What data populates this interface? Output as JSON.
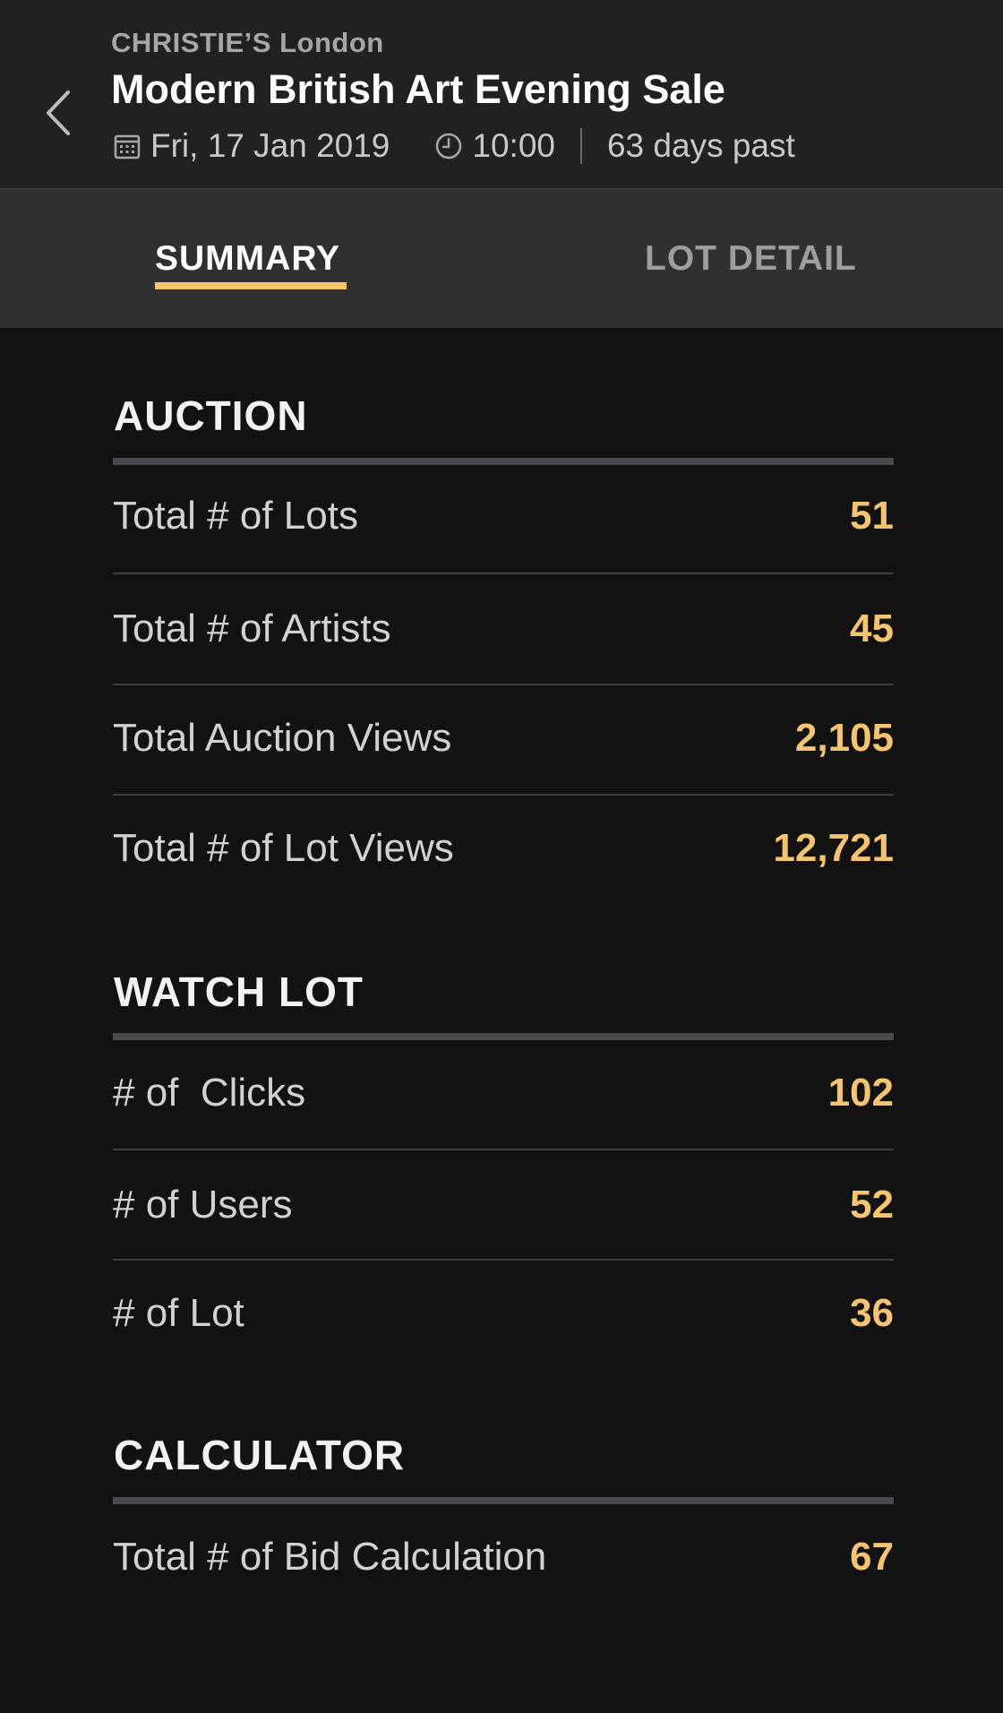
{
  "header": {
    "subtitle": "CHRISTIE’S London",
    "title": "Modern British Art Evening Sale",
    "date": "Fri, 17 Jan 2019",
    "time": "10:00",
    "status": "63 days past"
  },
  "tabs": [
    {
      "label": "SUMMARY",
      "active": true
    },
    {
      "label": "LOT DETAIL",
      "active": false
    }
  ],
  "sections": [
    {
      "title": "AUCTION",
      "rows": [
        {
          "label": "Total # of Lots",
          "value": "51"
        },
        {
          "label": "Total # of Artists",
          "value": "45"
        },
        {
          "label": "Total Auction Views",
          "value": "2,105"
        },
        {
          "label": "Total # of Lot Views",
          "value": "12,721"
        }
      ]
    },
    {
      "title": "WATCH LOT",
      "rows": [
        {
          "label": "# of  Clicks",
          "value": "102"
        },
        {
          "label": "# of Users",
          "value": "52"
        },
        {
          "label": "# of Lot",
          "value": "36"
        }
      ]
    },
    {
      "title": "CALCULATOR",
      "rows": [
        {
          "label": "Total # of Bid Calculation",
          "value": "67"
        }
      ]
    }
  ],
  "colors": {
    "accent": "#f5c46f",
    "background": "#121212",
    "header": "#212121",
    "tabbar": "#303030"
  },
  "icons": {
    "back": "chevron-left-icon",
    "date": "calendar-icon",
    "time": "clock-icon"
  }
}
